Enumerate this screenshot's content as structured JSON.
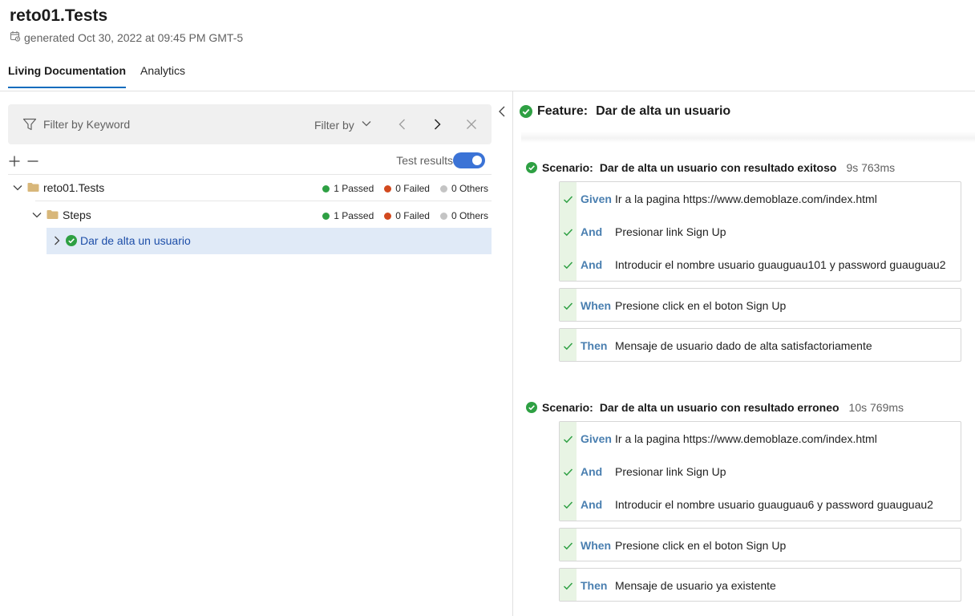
{
  "app": {
    "title": "reto01.Tests",
    "generated": "generated Oct 30, 2022 at 09:45 PM GMT-5"
  },
  "tabs": [
    {
      "label": "Living Documentation",
      "active": true
    },
    {
      "label": "Analytics",
      "active": false
    }
  ],
  "filter": {
    "placeholder": "Filter by Keyword",
    "filter_by_label": "Filter by"
  },
  "tree_tools": {
    "test_results_label": "Test results",
    "test_results_on": true
  },
  "tree": [
    {
      "label": "reto01.Tests",
      "passed": "1 Passed",
      "failed": "0 Failed",
      "others": "0 Others"
    },
    {
      "label": "Steps",
      "passed": "1 Passed",
      "failed": "0 Failed",
      "others": "0 Others"
    },
    {
      "label": "Dar de alta un usuario",
      "selected": true
    }
  ],
  "colors": {
    "passed": "#2ea043",
    "failed": "#d2491e",
    "others": "#c4c4c4",
    "accent": "#0f6cbd"
  },
  "feature": {
    "label": "Feature:",
    "title": "Dar de alta un usuario"
  },
  "scenarios": [
    {
      "label": "Scenario:",
      "title": "Dar de alta un usuario con resultado exitoso",
      "duration": "9s 763ms",
      "groups": [
        [
          {
            "keyword": "Given",
            "text": "Ir a la pagina https://www.demoblaze.com/index.html"
          },
          {
            "keyword": "And",
            "text": "Presionar link Sign Up"
          },
          {
            "keyword": "And",
            "text": "Introducir el nombre usuario guauguau101 y password guauguau2"
          }
        ],
        [
          {
            "keyword": "When",
            "text": "Presione click en el boton Sign Up"
          }
        ],
        [
          {
            "keyword": "Then",
            "text": "Mensaje de usuario dado de alta satisfactoriamente"
          }
        ]
      ]
    },
    {
      "label": "Scenario:",
      "title": "Dar de alta un usuario con resultado erroneo",
      "duration": "10s 769ms",
      "groups": [
        [
          {
            "keyword": "Given",
            "text": "Ir a la pagina https://www.demoblaze.com/index.html"
          },
          {
            "keyword": "And",
            "text": "Presionar link Sign Up"
          },
          {
            "keyword": "And",
            "text": "Introducir el nombre usuario guauguau6 y password guauguau2"
          }
        ],
        [
          {
            "keyword": "When",
            "text": "Presione click en el boton Sign Up"
          }
        ],
        [
          {
            "keyword": "Then",
            "text": "Mensaje de usuario ya existente"
          }
        ]
      ]
    }
  ]
}
